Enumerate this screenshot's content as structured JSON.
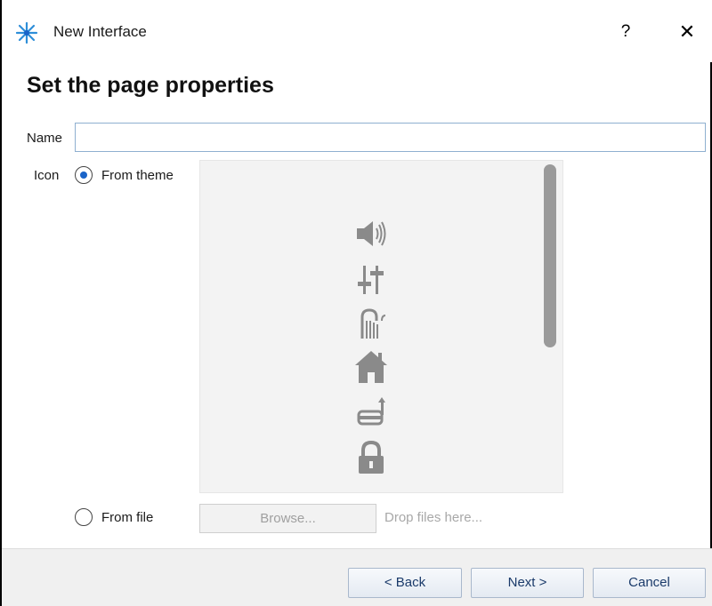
{
  "window": {
    "title": "New Interface",
    "help_label": "?",
    "close_label": "✕"
  },
  "page": {
    "heading": "Set the page properties"
  },
  "form": {
    "name_label": "Name",
    "name_value": "",
    "icon_label": "Icon",
    "from_theme_label": "From theme",
    "from_theme_selected": true,
    "from_file_label": "From file",
    "from_file_selected": false,
    "browse_label": "Browse...",
    "drop_text": "Drop files here..."
  },
  "icon_list": {
    "items": [
      "speaker-icon",
      "equalizer-sliders-icon",
      "shower-icon",
      "house-icon",
      "pool-lift-icon",
      "padlock-icon"
    ]
  },
  "footer": {
    "back_label": "< Back",
    "next_label": "Next >",
    "cancel_label": "Cancel"
  },
  "colors": {
    "accent": "#1a64c8",
    "icon_gray": "#8a8a8a",
    "footer_bg": "#f0f0f0"
  }
}
